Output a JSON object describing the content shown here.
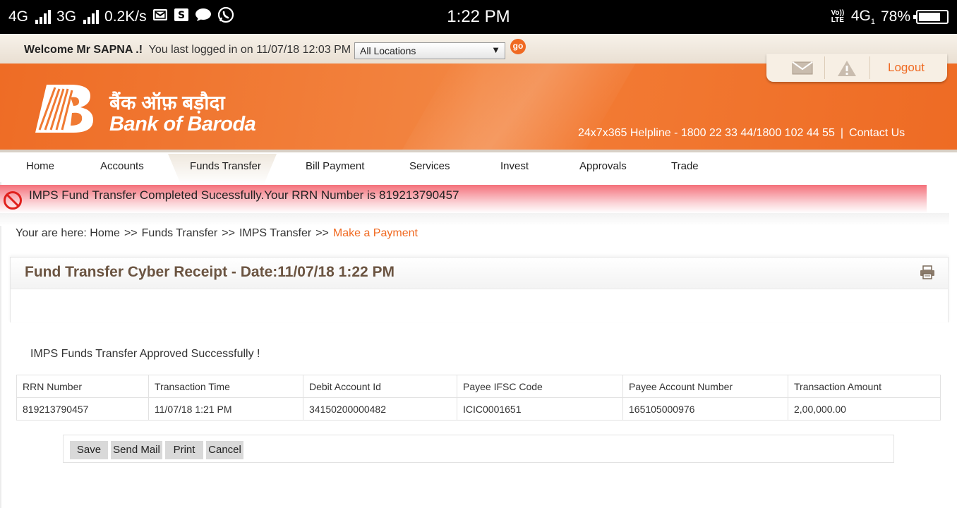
{
  "status_bar": {
    "network1": "4G",
    "network2": "3G",
    "speed": "0.2K/s",
    "time": "1:22 PM",
    "volte": "Vo)) LTE",
    "network3": "4G",
    "sim_slot": "1",
    "battery": "78%",
    "battery_level": 0.78,
    "icons": [
      "gmail-icon",
      "s-app-icon",
      "chat-icon",
      "whatsapp-icon"
    ]
  },
  "welcome": {
    "greeting": "Welcome Mr SAPNA .!",
    "last_login": "You last logged in on 11/07/18 12:03 PM",
    "location_select": "All Locations",
    "go_label": "go"
  },
  "header": {
    "bank_name_hindi": "बैंक ऑफ़ बड़ौदा",
    "bank_name": "Bank of Baroda",
    "helpline": "24x7x365 Helpline - 1800 22 33 44/1800 102 44 55",
    "separator": "|",
    "contact": "Contact Us",
    "logout": "Logout",
    "brand_color": "#ef6a22"
  },
  "nav": {
    "items": [
      "Home",
      "Accounts",
      "Funds Transfer",
      "Bill Payment",
      "Services",
      "Invest",
      "Approvals",
      "Trade"
    ],
    "active": "Funds Transfer"
  },
  "alert": {
    "message": "IMPS Fund Transfer Completed Sucessfully.Your RRN Number is 819213790457"
  },
  "breadcrumb": {
    "prefix": "Your are here:",
    "items": [
      "Home",
      "Funds Transfer",
      "IMPS Transfer"
    ],
    "separator": ">>",
    "current": "Make a Payment"
  },
  "receipt": {
    "title": "Fund Transfer Cyber Receipt - Date:11/07/18 1:22 PM",
    "status": "IMPS Funds Transfer Approved Successfully !",
    "columns": [
      "RRN Number",
      "Transaction Time",
      "Debit Account Id",
      "Payee IFSC Code",
      "Payee Account Number",
      "Transaction Amount"
    ],
    "rows": [
      [
        "819213790457",
        "11/07/18 1:21 PM",
        "34150200000482",
        "ICIC0001651",
        "165105000976",
        "2,00,000.00"
      ]
    ]
  },
  "actions": {
    "save": "Save",
    "send_mail": "Send Mail",
    "print": "Print",
    "cancel": "Cancel"
  }
}
